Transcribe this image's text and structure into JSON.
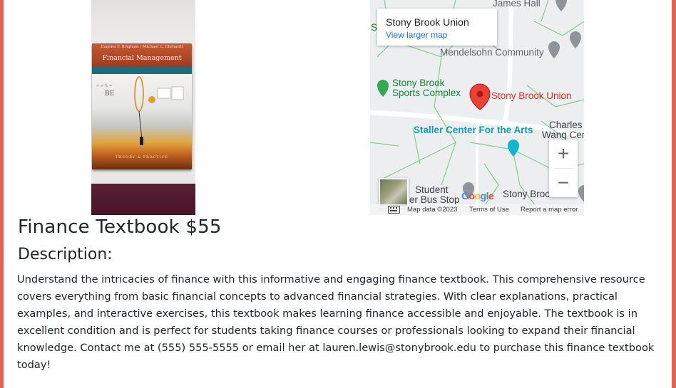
{
  "listing": {
    "heading": "Finance Textbook $55",
    "description_label": "Description:",
    "description": "Understand the intricacies of finance with this informative and engaging finance textbook. This comprehensive resource covers everything from basic financial concepts to advanced financial strategies. With clear explanations, practical examples, and interactive exercises, this textbook makes learning finance accessible and enjoyable. The textbook is in excellent condition and is perfect for students taking finance courses or professionals looking to expand their financial knowledge. Contact me at (555) 555-5555 or email her at lauren.lewis@stonybrook.edu to purchase this finance textbook today!"
  },
  "book_image": {
    "authors": "Eugene F. Brigham / Michael C. Ehrhardt",
    "title": "Financial Management",
    "subtitle": "THEORY & PRACTICE"
  },
  "map": {
    "place_name": "Stony Brook Union",
    "view_larger": "View larger map",
    "labels": {
      "james_hall": "James Hall",
      "mendelsohn": "Mendelsohn Community",
      "sports_complex_1": "Stony Brook",
      "sports_complex_2": "Sports Complex",
      "union": "Stony Brook Union",
      "staller": "Staller Center For the Arts",
      "charles_1": "Charles I",
      "charles_2": "Wang Cen",
      "student_1": "Student",
      "student_2": "er Bus Stop",
      "sb_bottom": "Stony Broo",
      "edge_s": "S"
    },
    "zoom_in": "+",
    "zoom_out": "−",
    "attribution": {
      "map_data": "Map data ©2023",
      "terms": "Terms of Use",
      "report": "Report a map error"
    },
    "colors": {
      "marker": "#ea4335",
      "park": "#188038",
      "transit": "#129eaf",
      "road_path": "#7fd08b"
    }
  },
  "icons": [
    "keyboard-icon",
    "map-marker-icon",
    "park-marker-icon",
    "transit-marker-icon"
  ]
}
